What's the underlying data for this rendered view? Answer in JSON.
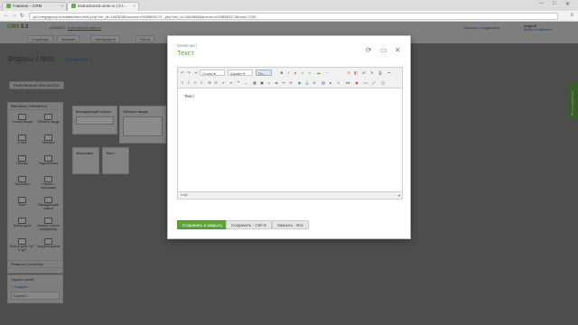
{
  "browser": {
    "tabs": [
      {
        "label": "Главная – CRM"
      },
      {
        "label": "instructions3.omni.ru | Ст..."
      }
    ],
    "url": "cp3.megagroup.ru/s/data/menu/edit.php?ver_id=1663838&access=u%3B609174...php?ver_id=1663838&access=u%3B609174&mod=7240",
    "win_controls": [
      "–",
      "□",
      "✕"
    ],
    "nav": [
      "←",
      "→",
      "↻"
    ],
    "menu": "≡"
  },
  "site": {
    "logo_cms": "CMS",
    "logo_ver": "5.3",
    "project_id": "p1524627",
    "project_link": "instructions3.omni.ru",
    "help": "Помощь и поддержка",
    "user_name": "Андрей",
    "user_sub": "Выйти из кабинета"
  },
  "toolbar": {
    "items": [
      {
        "label": "Страницы"
      },
      {
        "label": "Магазин"
      },
      {
        "label": "Настройки ▾"
      },
      {
        "label": "Почта"
      }
    ]
  },
  "page": {
    "title": "Формы / test",
    "instructions": "Инструкция",
    "results_btn": "Полученные результаты"
  },
  "sidebar": {
    "heading": "Базовые элементы",
    "elements": [
      {
        "label": "Строка ввода"
      },
      {
        "label": "Область ввода"
      },
      {
        "label": "E-mail"
      },
      {
        "label": "Телефон"
      },
      {
        "label": "Галочка"
      },
      {
        "label": "Радиокнопка"
      },
      {
        "label": "Заголовок"
      },
      {
        "label": "Список с галочками"
      },
      {
        "label": "Текст"
      },
      {
        "label": "Выпадающий список"
      },
      {
        "label": "Выбор даты"
      },
      {
        "label": "Список с ранее выбранным"
      },
      {
        "label": "Выбор даты \"от\" и \"до\""
      },
      {
        "label": "Загрузка файла"
      }
    ],
    "section2": "Разметка (колонки)",
    "groups_title": "Группы полей",
    "groups_add": "+ Создать",
    "group1": "Группа 1"
  },
  "panes": {
    "dropdown": "Выпадающий список",
    "textarea": "Область ввода",
    "heading": "Заголовок",
    "text": "Текст"
  },
  "side_tab": "Есть вопросы?",
  "modal": {
    "crumb": "Свойства /",
    "title": "Текст",
    "icons": {
      "pin": "⟳",
      "maximize": "▭",
      "close": "✕"
    },
    "editor": {
      "styles_label": "Стили",
      "font_label": "Шрифт",
      "size_label": "Ра...",
      "content": "Текст",
      "status_path": "body"
    },
    "buttons": {
      "save_close": "Сохранить и закрыть",
      "save": "Сохранить - Ctrl+S",
      "close": "Закрыть - Esc"
    }
  }
}
